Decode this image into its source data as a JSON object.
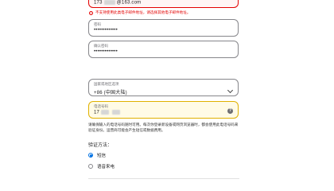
{
  "email": {
    "value_prefix": "173",
    "value_suffix": "@163.com",
    "error_text": "不支持使用此类电子邮件地址，请选择其他电子邮件地址。"
  },
  "password": {
    "label": "密码",
    "value": "•••••••••••••"
  },
  "confirm_password": {
    "label": "确认密码",
    "value": "•••••••••••••"
  },
  "country": {
    "label": "国家或地区选项",
    "value": "+86 (中国大陆)"
  },
  "phone": {
    "label": "电话号码",
    "value_prefix": "17",
    "help_icon": "?"
  },
  "info_text": "请确保输入的电话号码随时可用。每次你登录新设备或网页浏览器时，都会使用此电话号码来验证身份。运营商可能会产生短信或数据费用。",
  "verify": {
    "title": "验证方法：",
    "options": [
      {
        "label": "短信",
        "selected": true
      },
      {
        "label": "语音来电",
        "selected": false
      }
    ]
  },
  "colors": {
    "error": "#e30000",
    "warning_border": "#e0b100",
    "accent": "#0071e3"
  }
}
